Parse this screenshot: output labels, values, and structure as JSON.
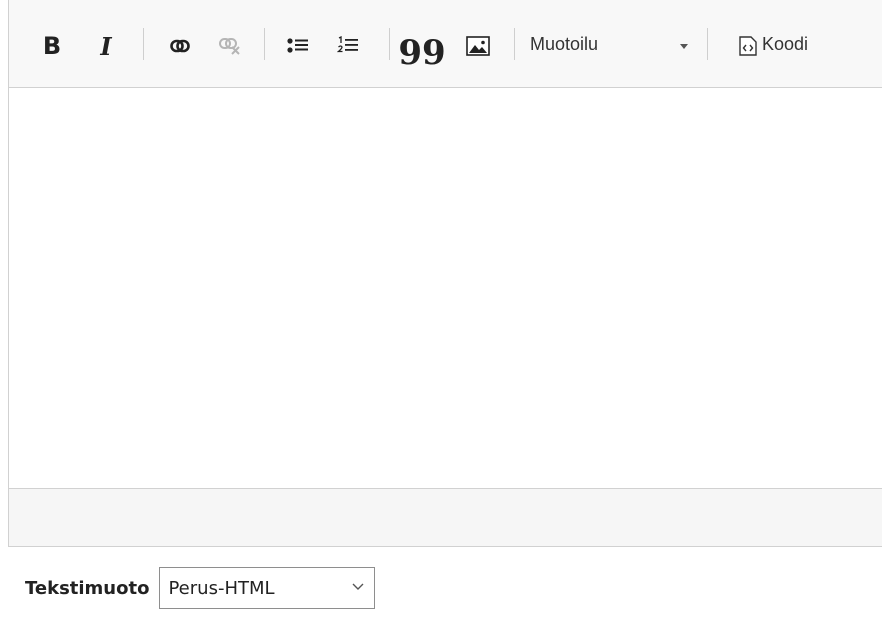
{
  "toolbar": {
    "bold_glyph": "B",
    "italic_glyph": "I",
    "blockquote_glyph": "99",
    "format_dropdown_label": "Muotoilu",
    "source_button_label": "Koodi"
  },
  "text_format": {
    "label": "Tekstimuoto",
    "selected": "Perus-HTML"
  }
}
